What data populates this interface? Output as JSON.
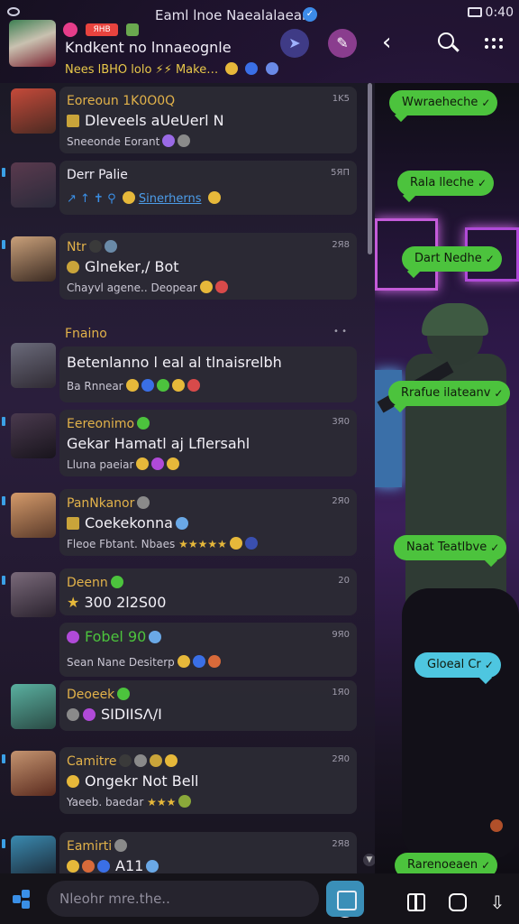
{
  "status_bar": {
    "title": "Eaml lnoe Naealalaeara",
    "time": "0:40"
  },
  "header": {
    "badge_label": "ЯНВ",
    "title": "Kndkent no lnnaeognle",
    "subtitle": "Nees lBHO lolo ⚡⚡ Make…"
  },
  "chats": [
    {
      "name": "Eoreoun 1K0O0Q",
      "time": "1K5",
      "message": "Dleveels aUeUerl N",
      "preview": "Sneeonde Eorant",
      "avatar_colors": [
        "#c54a3a",
        "#4a2a22"
      ]
    },
    {
      "name": "Derr Palie",
      "time": "5ЯΠ",
      "message": "",
      "preview": "Sinerherns",
      "avatar_colors": [
        "#5a3a4e",
        "#2a2a3a"
      ]
    },
    {
      "name": "Ntr",
      "time": "2Я8",
      "message": "Glneker,/ Bot",
      "preview": "Chayvl agene.. Deopear",
      "avatar_colors": [
        "#c9a07a",
        "#3a2a22"
      ]
    },
    {
      "name": "Fnaino",
      "time": "",
      "message": "Betenlanno l eal al tlnaisrelbh",
      "preview": "Ba Rnnear",
      "avatar_colors": [
        "#6a6a7a",
        "#2f2a33"
      ]
    },
    {
      "name": "Eereonimo",
      "time": "3Я0",
      "message": "Gekar Hamatl aj Lflersahl",
      "preview": "Lluna paeiar",
      "avatar_colors": [
        "#4a3a4e",
        "#18141c"
      ]
    },
    {
      "name": "PanNkanor",
      "time": "2Я0",
      "message": "Coekekonna",
      "preview": "Fleoe Fbtant. Nbaes",
      "avatar_colors": [
        "#d49a6a",
        "#5a3a2a"
      ]
    },
    {
      "name": "Deenn",
      "time": "20",
      "message": "300   2l2S00",
      "preview": "",
      "avatar_colors": [
        "#7a6a7a",
        "#2a222e"
      ]
    },
    {
      "name": "",
      "time": "9Я0",
      "message": "Fobel 90",
      "preview": "Sean Nane   Desiterp",
      "avatar_colors": [
        "#000000",
        "#000000"
      ]
    },
    {
      "name": "Deoeek",
      "time": "1Я0",
      "message": "SIDIISΛ/I",
      "preview": "",
      "avatar_colors": [
        "#5ab0a0",
        "#2a4a44"
      ]
    },
    {
      "name": "Camitre",
      "time": "2Я0",
      "message": "Ongekr Not Bell",
      "preview": "Yaeeb. baedar",
      "avatar_colors": [
        "#c49470",
        "#5a2a1e"
      ]
    },
    {
      "name": "Eamirti",
      "time": "2Я8",
      "message": "A11",
      "preview": "",
      "avatar_colors": [
        "#3a8ab0",
        "#1a2430"
      ]
    }
  ],
  "tags": [
    {
      "label": "Wwraeheche",
      "color": "green"
    },
    {
      "label": "Rala lleche",
      "color": "green"
    },
    {
      "label": "Dart Nedhe",
      "color": "green"
    },
    {
      "label": "Rrafue ilateanv",
      "color": "green"
    },
    {
      "label": "Naat Teatlbve",
      "color": "green"
    },
    {
      "label": "Gloeal Cr",
      "color": "cyan"
    },
    {
      "label": "Rarenoeaen",
      "color": "green"
    }
  ],
  "input": {
    "placeholder": "Nleohr mre.the.."
  },
  "colors": {
    "accent_green": "#4cc33d",
    "accent_cyan": "#4ec6e0",
    "name_gold": "#e2b24a",
    "link_blue": "#4c9ce8"
  }
}
